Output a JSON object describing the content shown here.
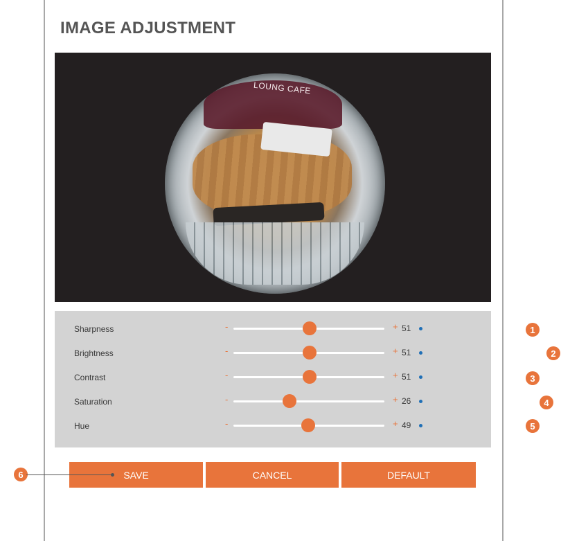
{
  "page": {
    "title": "IMAGE ADJUSTMENT"
  },
  "video": {
    "overlay_text": "LOUNG CAFE"
  },
  "settings": [
    {
      "label": "Sharpness",
      "minus": "-",
      "plus": "+",
      "value": "51",
      "level": 51
    },
    {
      "label": "Brightness",
      "minus": "-",
      "plus": "+",
      "value": "51",
      "level": 51
    },
    {
      "label": "Contrast",
      "minus": "-",
      "plus": "+",
      "value": "51",
      "level": 51
    },
    {
      "label": "Saturation",
      "minus": "-",
      "plus": "+",
      "value": "26",
      "level": 26
    },
    {
      "label": "Hue",
      "minus": "-",
      "plus": "+",
      "value": "49",
      "level": 49
    }
  ],
  "buttons": {
    "save": "SAVE",
    "cancel": "CANCEL",
    "default": "DEFAULT"
  },
  "callouts": [
    "1",
    "2",
    "3",
    "4",
    "5",
    "6"
  ],
  "colors": {
    "accent": "#e8743b",
    "indicator": "#1f6fb6",
    "panel": "#d3d3d3",
    "video_bg": "#231f20"
  }
}
